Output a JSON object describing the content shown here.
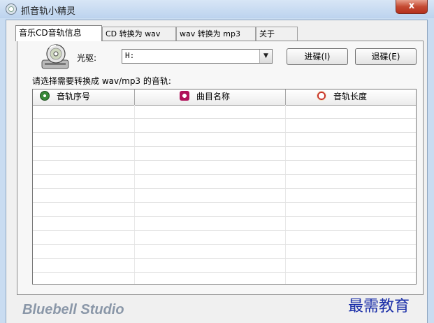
{
  "window": {
    "title": "抓音轨小精灵",
    "close_label": "x"
  },
  "tabs": [
    {
      "label": "音乐CD音轨信息",
      "active": true
    },
    {
      "label": "CD 转换为 wav",
      "active": false
    },
    {
      "label": "wav 转换为 mp3",
      "active": false
    },
    {
      "label": "关于",
      "active": false
    }
  ],
  "drive": {
    "label": "光驱:",
    "value": "H:"
  },
  "buttons": {
    "load": "进碟(I)",
    "eject": "退碟(E)"
  },
  "instruction": "请选择需要转换成 wav/mp3 的音轨:",
  "columns": [
    {
      "label": "音轨序号",
      "icon": "cd-note-icon"
    },
    {
      "label": "曲目名称",
      "icon": "music-box-icon"
    },
    {
      "label": "音轨长度",
      "icon": "clock-icon"
    }
  ],
  "footer_brand": "Bluebell Studio",
  "watermark": "最需教育",
  "colors": {
    "title_bg": "#c9dcf1",
    "close_red": "#c44a32",
    "brand_gray": "#8a97a8",
    "watermark_blue": "#1a2ea8"
  }
}
